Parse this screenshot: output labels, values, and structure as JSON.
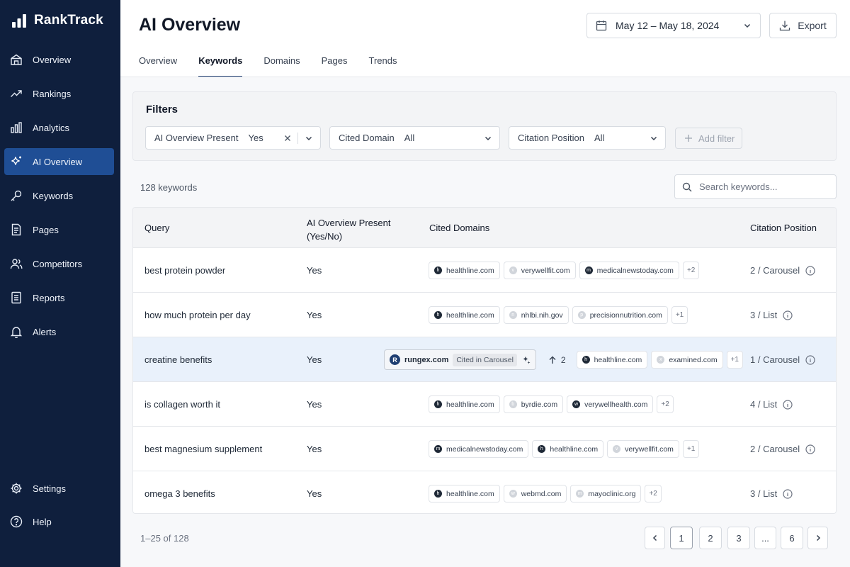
{
  "brand": {
    "name": "RankTrack"
  },
  "sidebar": {
    "items": [
      {
        "label": "Overview",
        "icon": "home-icon"
      },
      {
        "label": "Rankings",
        "icon": "trending-up-icon"
      },
      {
        "label": "Analytics",
        "icon": "bar-chart-icon"
      },
      {
        "label": "AI Overview",
        "icon": "sparkle-icon",
        "active": true
      },
      {
        "label": "Keywords",
        "icon": "key-icon"
      },
      {
        "label": "Pages",
        "icon": "document-icon"
      },
      {
        "label": "Competitors",
        "icon": "users-icon"
      },
      {
        "label": "Reports",
        "icon": "report-icon"
      },
      {
        "label": "Alerts",
        "icon": "bell-icon"
      }
    ],
    "bottom": [
      {
        "label": "Settings",
        "icon": "gear-icon"
      },
      {
        "label": "Help",
        "icon": "help-icon"
      }
    ]
  },
  "header": {
    "title": "AI Overview",
    "date_range": "May 12 – May 18, 2024",
    "export_label": "Export"
  },
  "tabs": [
    "Overview",
    "Keywords",
    "Domains",
    "Pages",
    "Trends"
  ],
  "active_tab": "Keywords",
  "filters": {
    "title": "Filters",
    "items": [
      {
        "label": "AI Overview Present",
        "value": "Yes"
      },
      {
        "label": "Cited Domain",
        "value": "All"
      },
      {
        "label": "Citation Position",
        "value": "All"
      }
    ],
    "add_label": "Add filter"
  },
  "summary": {
    "count": "128 keywords"
  },
  "search": {
    "placeholder": "Search keywords..."
  },
  "table": {
    "headers": {
      "query": "Query",
      "present_line1": "AI Overview Present",
      "present_line2": "(Yes/No)",
      "domains": "Cited Domains",
      "position": "Citation Position"
    },
    "rows": [
      {
        "query": "best protein powder",
        "present": "Yes",
        "domains": [
          "healthline.com",
          "verywellfit.com",
          "medicalnewstoday.com"
        ],
        "more": "+2",
        "position": "2 / Carousel"
      },
      {
        "query": "how much protein per day",
        "present": "Yes",
        "domains": [
          "healthline.com",
          "nhlbi.nih.gov",
          "precisionnutrition.com"
        ],
        "more": "+1",
        "position": "3 / List"
      },
      {
        "query": "creatine benefits",
        "present": "Yes",
        "highlight": {
          "domain": "rungex.com",
          "badge": "Cited in Carousel",
          "logo": "R",
          "delta": "2"
        },
        "domains": [
          "healthline.com",
          "examined.com"
        ],
        "more": "+1",
        "position": "1 / Carousel"
      },
      {
        "query": "is collagen worth it",
        "present": "Yes",
        "domains": [
          "healthline.com",
          "byrdie.com",
          "verywellhealth.com"
        ],
        "more": "+2",
        "position": "4 / List"
      },
      {
        "query": "best magnesium supplement",
        "present": "Yes",
        "domains": [
          "medicalnewstoday.com",
          "healthline.com",
          "verywellfit.com"
        ],
        "more": "+1",
        "position": "2 / Carousel"
      },
      {
        "query": "omega 3 benefits",
        "present": "Yes",
        "domains": [
          "healthline.com",
          "webmd.com",
          "mayoclinic.org"
        ],
        "more": "+2",
        "position": "3 / List"
      }
    ]
  },
  "pagination": {
    "info": "1–25 of 128",
    "pages": [
      "1",
      "2",
      "3",
      "...",
      "6"
    ],
    "current": "1"
  }
}
